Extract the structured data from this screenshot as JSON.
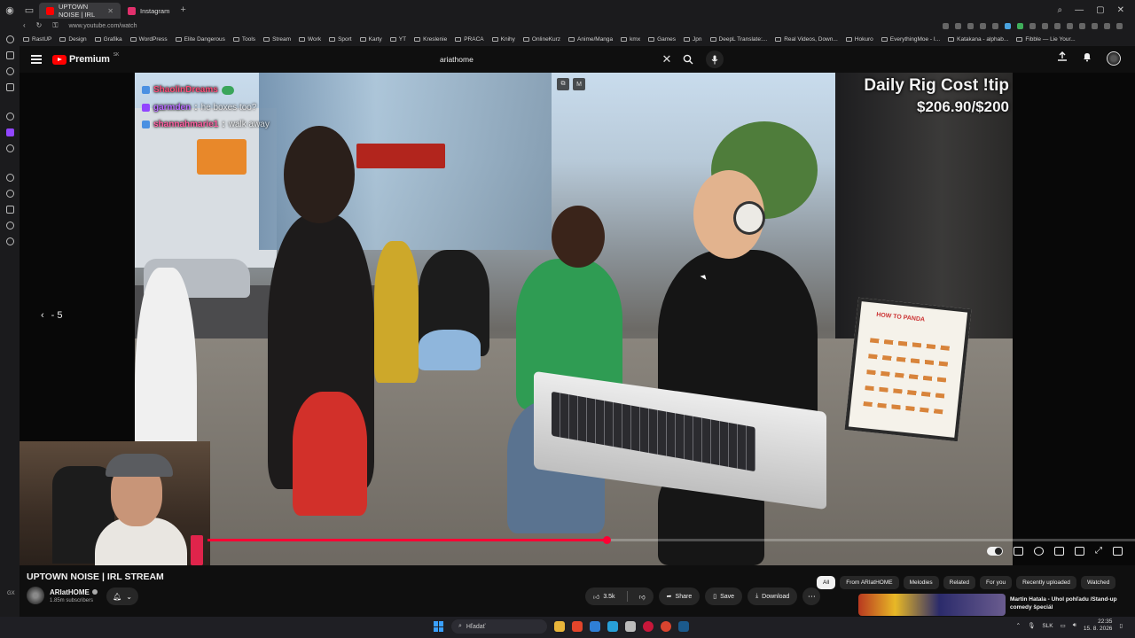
{
  "browser": {
    "tabs": [
      {
        "label": "UPTOWN NOISE | IRL",
        "active": true,
        "favicon_color": "#ff0000"
      },
      {
        "label": "Instagram",
        "active": false,
        "favicon_color": "#e1306c"
      }
    ],
    "new_tab": "+",
    "url": "www.youtube.com/watch",
    "bookmarks": [
      "RastUP",
      "Design",
      "Grafika",
      "WordPress",
      "Elite Dangerous",
      "Tools",
      "Stream",
      "Work",
      "Sport",
      "Karty",
      "YT",
      "Kreslenie",
      "PRACA",
      "Knihy",
      "OnlineKurz",
      "Anime/Manga",
      "kmx",
      "Games",
      "Jpn",
      "DeepL Translate:...",
      "Real Videos, Down...",
      "Hokuro",
      "EverythingMoe - I...",
      "Katakana - alphab...",
      "Fibble — Lie Your..."
    ]
  },
  "youtube": {
    "brand": "Premium",
    "country": "SK",
    "search_value": "ariathome"
  },
  "stream_overlay": {
    "chat": [
      {
        "user": "ShaolinDreams",
        "msg": "",
        "color": "#ff4f7b"
      },
      {
        "user": "garmden",
        "msg": "he boxes too?",
        "color": "#b86bff"
      },
      {
        "user": "shannahmarie1",
        "msg": "walk away",
        "color": "#ff5fa2"
      }
    ],
    "title_line1": "Daily Rig Cost !tip",
    "title_line2": "$206.90/$200",
    "seek_text": "- 5"
  },
  "player": {
    "progress": 0.43
  },
  "video": {
    "title": "UPTOWN NOISE | IRL STREAM",
    "channel": "ARIatHOME",
    "subscribers": "1.85m subscribers",
    "likes": "3.5k",
    "share": "Share",
    "save": "Save",
    "download": "Download"
  },
  "chips": [
    "All",
    "From ARIatHOME",
    "Melodies",
    "Related",
    "For you",
    "Recently uploaded",
    "Watched"
  ],
  "recommendation": {
    "title": "Martin Hatala - Uhol pohľadu /Stand-up comedy špeciál"
  },
  "taskbar": {
    "search": "Hľadať",
    "lang": "SLK",
    "time": "22:35",
    "date": "15. 8. 2026"
  },
  "colors": {
    "accent": "#ff0033",
    "youtube_red": "#ff0000",
    "bg": "#0f0f0f"
  }
}
